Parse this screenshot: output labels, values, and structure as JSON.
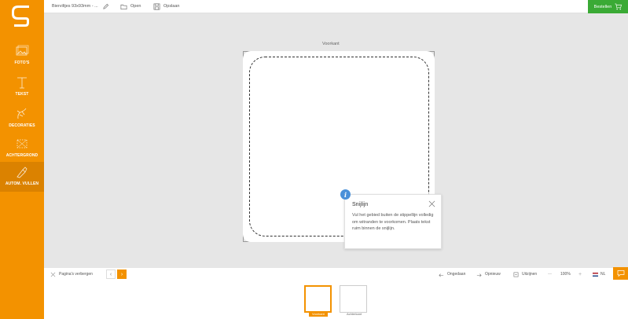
{
  "sidebar": {
    "items": [
      {
        "label": "FOTO'S",
        "icon": "photo-icon"
      },
      {
        "label": "TEKST",
        "icon": "text-icon"
      },
      {
        "label": "DECORATIES",
        "icon": "decoration-icon"
      },
      {
        "label": "ACHTERGROND",
        "icon": "background-icon"
      },
      {
        "label": "AUTOM. VULLEN",
        "icon": "auto-fill-icon"
      }
    ]
  },
  "topbar": {
    "document_title": "Bierviltjes 93x93mm - ...",
    "open_label": "Open",
    "save_label": "Opslaan",
    "order_label": "Bestellen"
  },
  "canvas": {
    "side_label": "Voorkant"
  },
  "tooltip": {
    "title": "Snijlijn",
    "body": "Vul het gebied buiten de stippellijn volledig om witranden te voorkomen. Plaats tekst ruim binnen de snijlijn."
  },
  "bottombar": {
    "hide_pages_label": "Pagina's verbergen",
    "undo_label": "Ongedaan",
    "redo_label": "Opnieuw",
    "zoom_out_label": "Uitzijnen",
    "zoom_level": "100%",
    "language": "NL"
  },
  "pages": [
    {
      "label": "Voorkant",
      "active": true
    },
    {
      "label": "Achterkant",
      "active": false
    }
  ],
  "colors": {
    "brand": "#f39200",
    "order": "#3aaa35",
    "info": "#4a90d9"
  }
}
